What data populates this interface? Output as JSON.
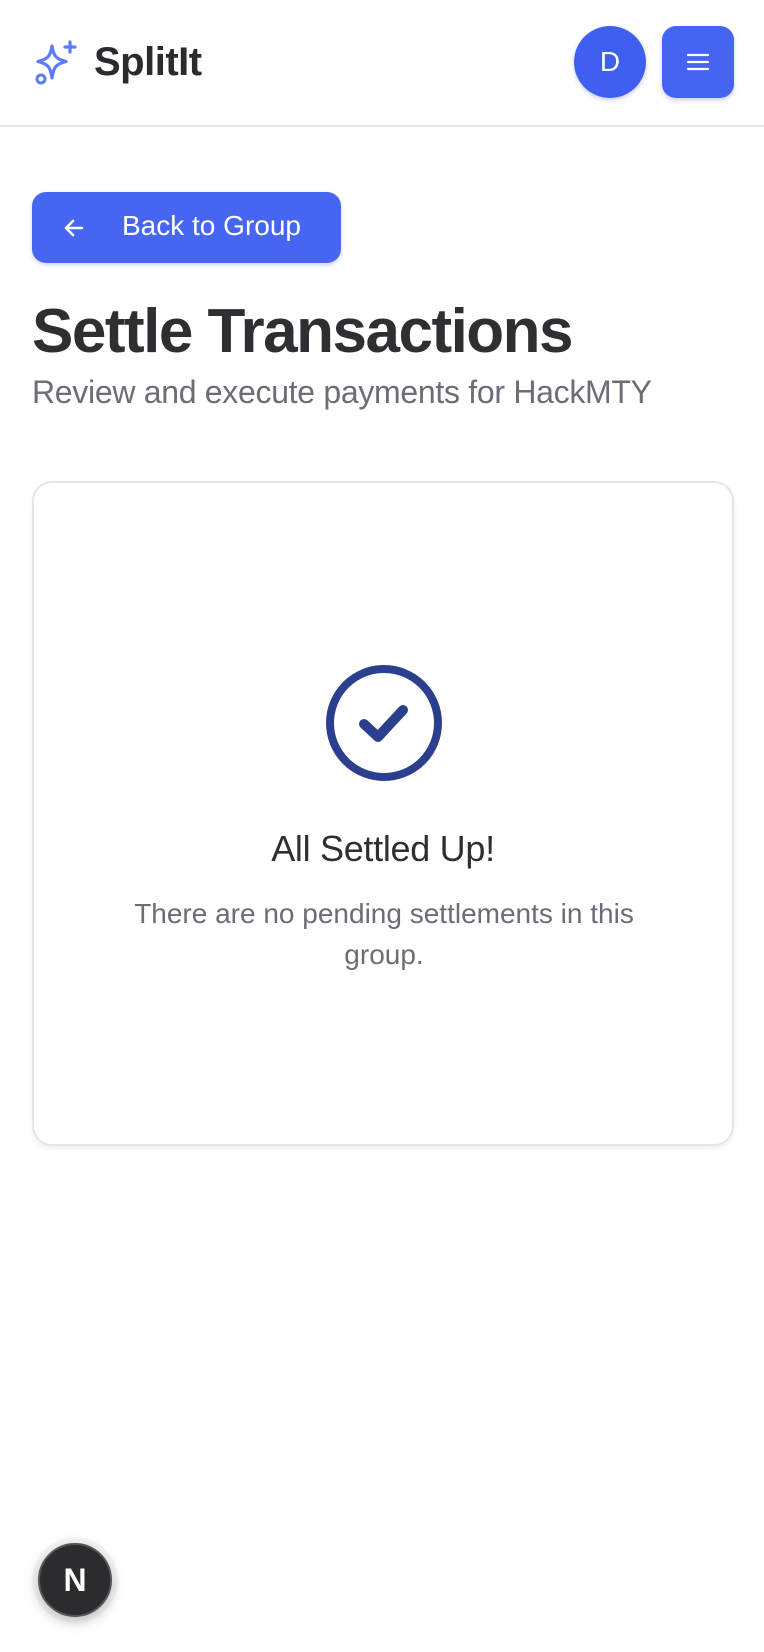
{
  "header": {
    "brand_name": "SplitIt",
    "avatar_initial": "D"
  },
  "nav": {
    "back_label": "Back to Group"
  },
  "page": {
    "title": "Settle Transactions",
    "subtitle": "Review and execute payments for HackMTY"
  },
  "empty_state": {
    "title": "All Settled Up!",
    "description": "There are no pending settlements in this group."
  },
  "badge": {
    "letter": "N"
  },
  "colors": {
    "primary": "#4464f1",
    "check_ring": "#2c3f8f",
    "brand_icon": "#5b7cf5"
  },
  "icons": {
    "brand": "sparkle-icon",
    "menu": "hamburger-menu-icon",
    "back": "arrow-left-icon",
    "status": "check-circle-icon"
  }
}
